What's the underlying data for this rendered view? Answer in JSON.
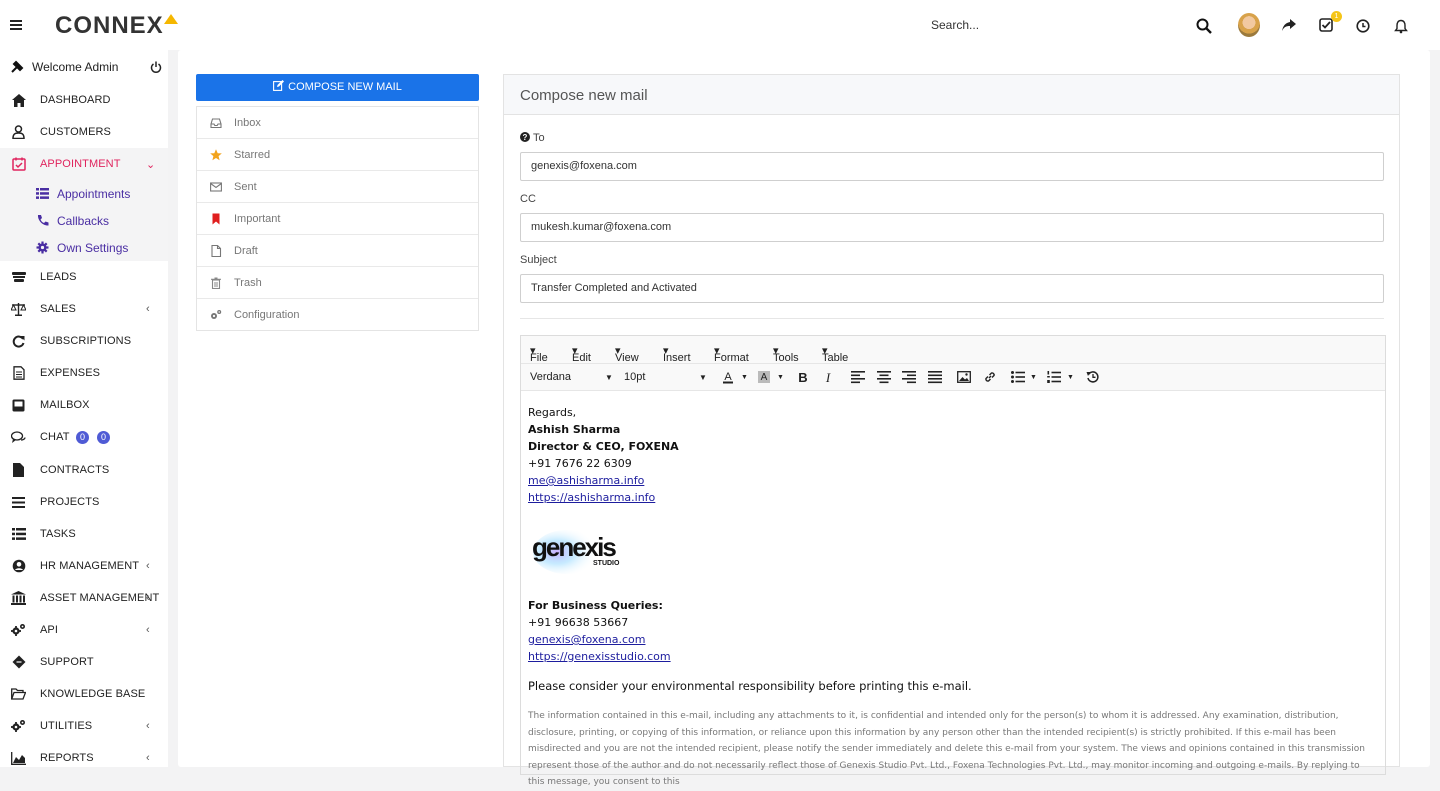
{
  "topbar": {
    "logo": "CONNEX",
    "search_placeholder": "Search...",
    "task_badge": "1"
  },
  "sidebar": {
    "welcome": "Welcome Admin",
    "items": [
      {
        "label": "DASHBOARD"
      },
      {
        "label": "CUSTOMERS"
      },
      {
        "label": "APPOINTMENT"
      },
      {
        "label": "LEADS"
      },
      {
        "label": "SALES"
      },
      {
        "label": "SUBSCRIPTIONS"
      },
      {
        "label": "EXPENSES"
      },
      {
        "label": "MAILBOX"
      },
      {
        "label": "CHAT"
      },
      {
        "label": "CONTRACTS"
      },
      {
        "label": "PROJECTS"
      },
      {
        "label": "TASKS"
      },
      {
        "label": "HR MANAGEMENT"
      },
      {
        "label": "ASSET MANAGEMENT"
      },
      {
        "label": "API"
      },
      {
        "label": "SUPPORT"
      },
      {
        "label": "KNOWLEDGE BASE"
      },
      {
        "label": "UTILITIES"
      },
      {
        "label": "REPORTS"
      }
    ],
    "sub_items": [
      {
        "label": "Appointments"
      },
      {
        "label": "Callbacks"
      },
      {
        "label": "Own Settings"
      }
    ],
    "chat_badges": [
      "0",
      "0"
    ]
  },
  "mail": {
    "compose_button": "COMPOSE NEW MAIL",
    "folders": [
      {
        "label": "Inbox"
      },
      {
        "label": "Starred"
      },
      {
        "label": "Sent"
      },
      {
        "label": "Important"
      },
      {
        "label": "Draft"
      },
      {
        "label": "Trash"
      },
      {
        "label": "Configuration"
      }
    ]
  },
  "compose": {
    "title": "Compose new mail",
    "to_label": "To",
    "to_value": "genexis@foxena.com",
    "cc_label": "CC",
    "cc_value": "mukesh.kumar@foxena.com",
    "subject_label": "Subject",
    "subject_value": "Transfer Completed and Activated"
  },
  "editor": {
    "menus": [
      "File",
      "Edit",
      "View",
      "Insert",
      "Format",
      "Tools",
      "Table"
    ],
    "font_family": "Verdana",
    "font_size": "10pt",
    "body": {
      "regards": "Regards,",
      "name": "Ashish Sharma",
      "title": "Director & CEO, FOXENA",
      "phone": "+91 7676 22 6309",
      "email": "me@ashisharma.info",
      "website": "https://ashisharma.info",
      "logo_text": "genexis",
      "logo_sub": "STUDIO",
      "biz_heading": "For Business Queries:",
      "biz_phone": "+91 96638 53667",
      "biz_email": "genexis@foxena.com",
      "biz_site": "https://genexisstudio.com",
      "env_note": "Please consider your environmental responsibility before printing this e-mail.",
      "disclaimer": "The information contained in this e-mail, including any attachments to it, is confidential and intended only for the person(s) to whom it is addressed. Any examination, distribution, disclosure, printing, or copying of this information, or reliance upon this information by any person other than the intended recipient(s) is strictly prohibited. If this e-mail has been misdirected and you are not the intended recipient, please notify the sender immediately and delete this e-mail from your system. The views and opinions contained in this transmission represent those of the author and do not necessarily reflect those of Genexis Studio Pvt. Ltd., Foxena Technologies Pvt. Ltd., may monitor incoming and outgoing e-mails. By replying to this message, you consent to this"
    }
  },
  "colors": {
    "accent_blue": "#1a73e8",
    "active_pink": "#e0245e",
    "sub_purple": "#4a2ea3",
    "badge_blue": "#4f5bd5",
    "badge_yellow": "#f5c518"
  }
}
